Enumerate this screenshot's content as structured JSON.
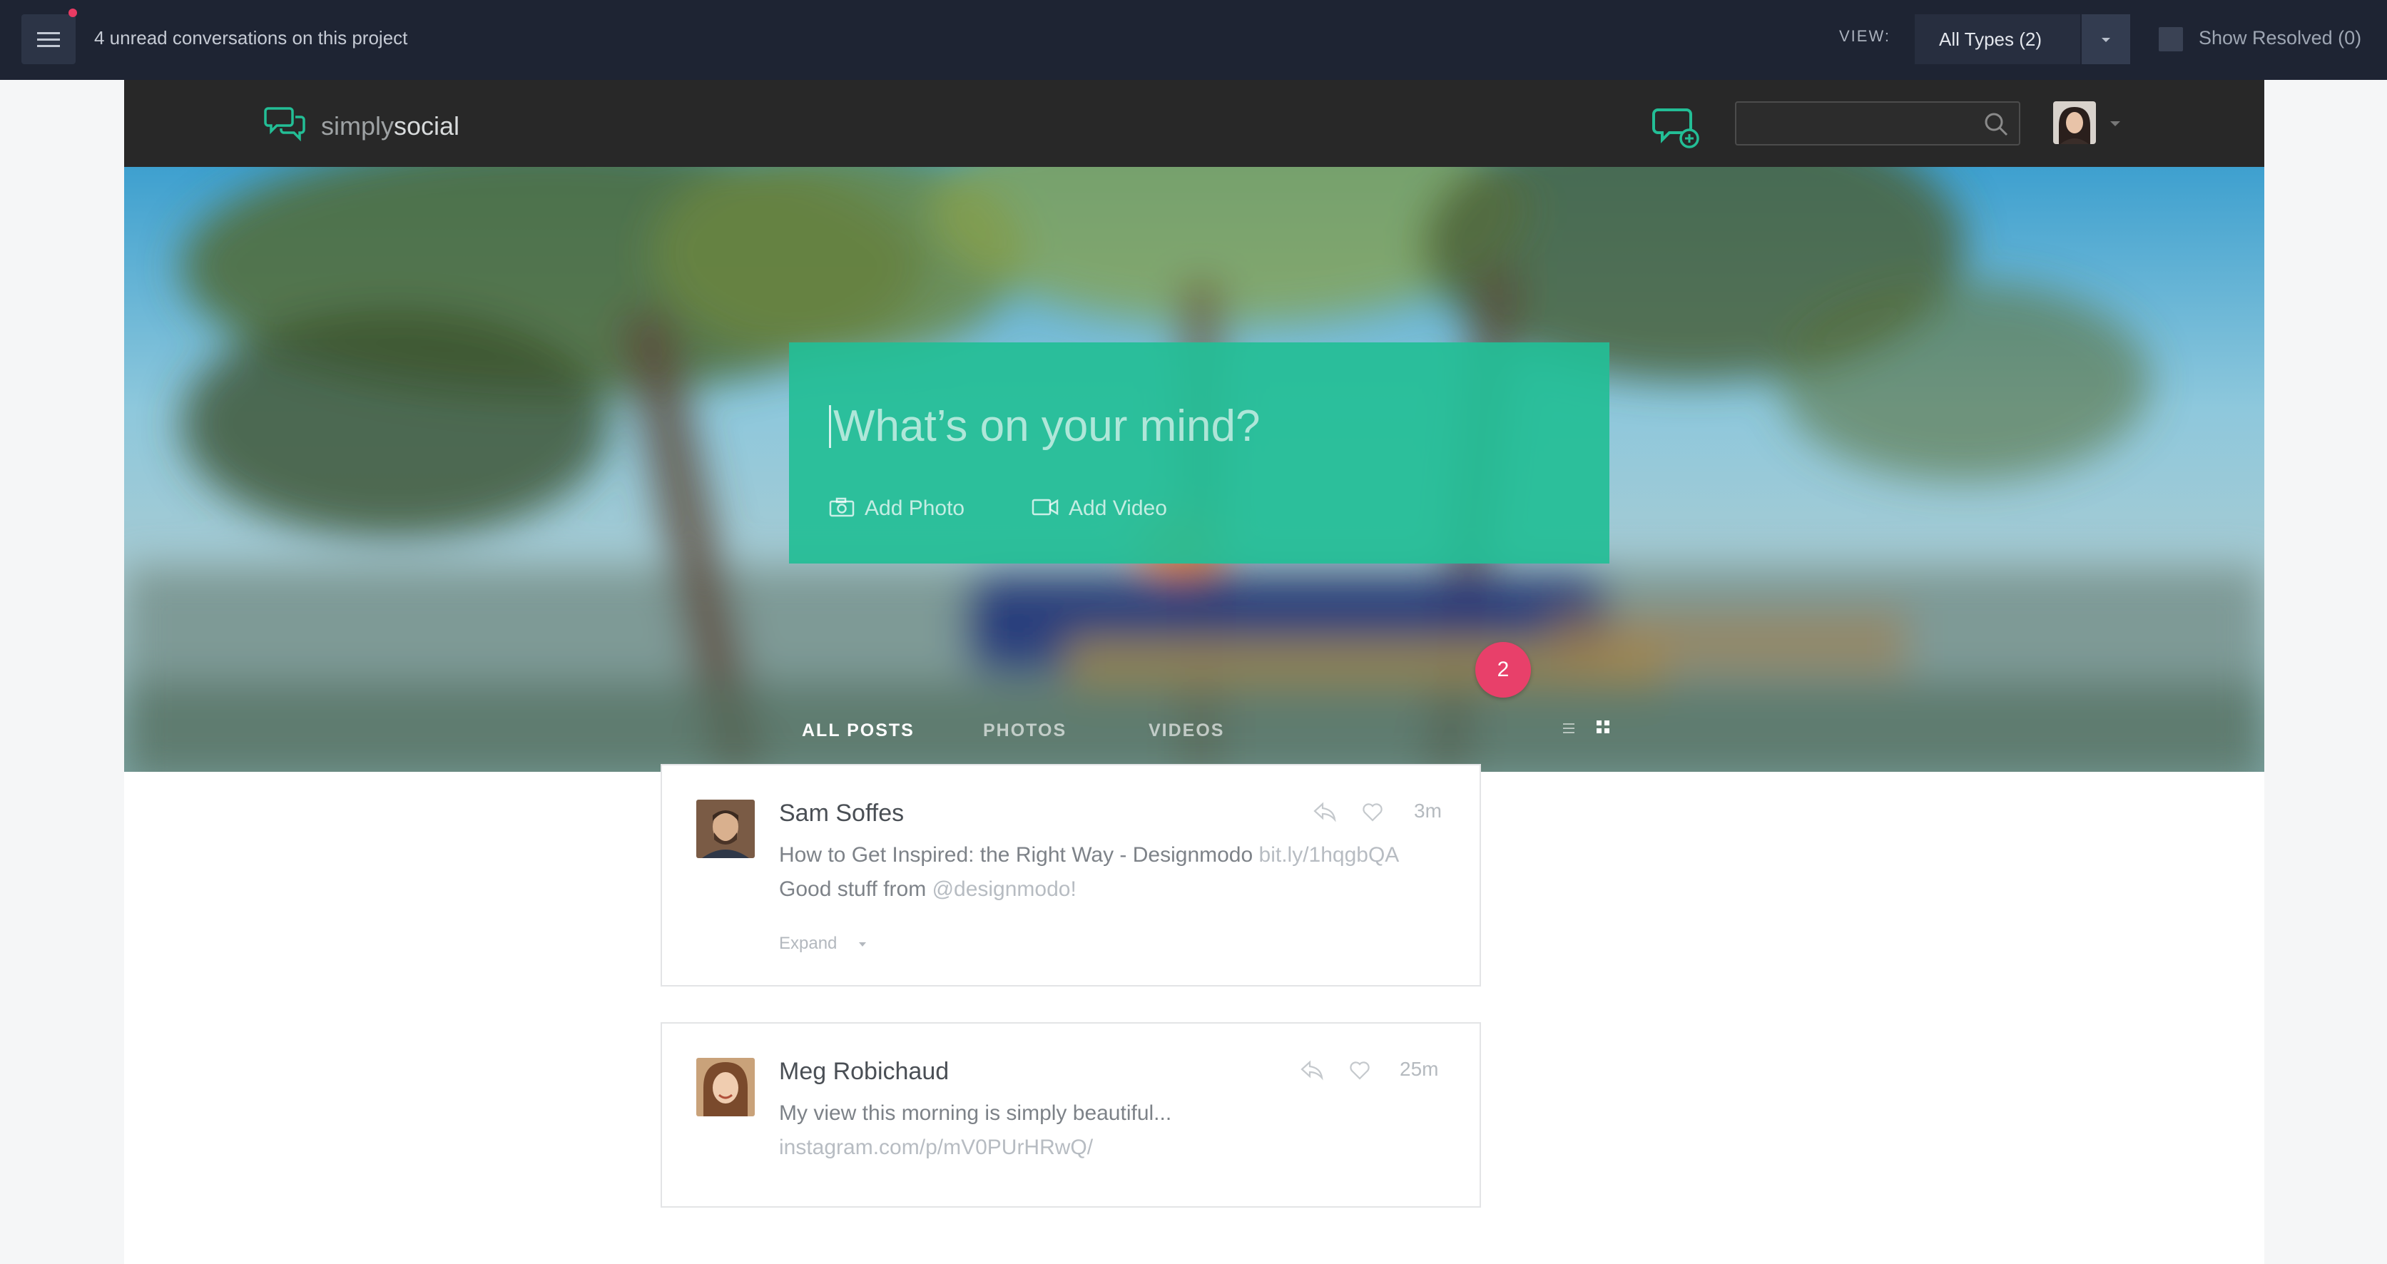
{
  "review_bar": {
    "unread_text": "4 unread conversations on this project",
    "view_label": "VIEW:",
    "type_select_value": "All Types (2)",
    "show_resolved_label": "Show Resolved (0)",
    "notification_dot_color": "#e93b63"
  },
  "app": {
    "logo": {
      "part1": "simply",
      "part2": "social",
      "icon": "chat-bubbles-icon"
    },
    "header_icons": [
      "new-conversation-icon",
      "search-icon",
      "avatar",
      "chevron-down-icon"
    ],
    "search": {
      "placeholder": ""
    }
  },
  "composer": {
    "placeholder": "What’s on your mind?",
    "add_photo": "Add Photo",
    "add_video": "Add Video",
    "color": "#23be96"
  },
  "notification_badge": {
    "count": "2",
    "color": "#e8406a"
  },
  "tabs": [
    {
      "label": "ALL POSTS",
      "active": true
    },
    {
      "label": "PHOTOS",
      "active": false
    },
    {
      "label": "VIDEOS",
      "active": false
    }
  ],
  "feed": [
    {
      "author": "Sam Soffes",
      "time": "3m",
      "text": "How to Get Inspired: the Right Way - Designmodo",
      "link": "bit.ly/1hqgbQA",
      "text2": "Good stuff from",
      "mention": "@designmodo!",
      "expand_label": "Expand"
    },
    {
      "author": "Meg Robichaud",
      "time": "25m",
      "text": "My view this morning is simply beautiful...",
      "link": "instagram.com/p/mV0PUrHRwQ/"
    }
  ]
}
